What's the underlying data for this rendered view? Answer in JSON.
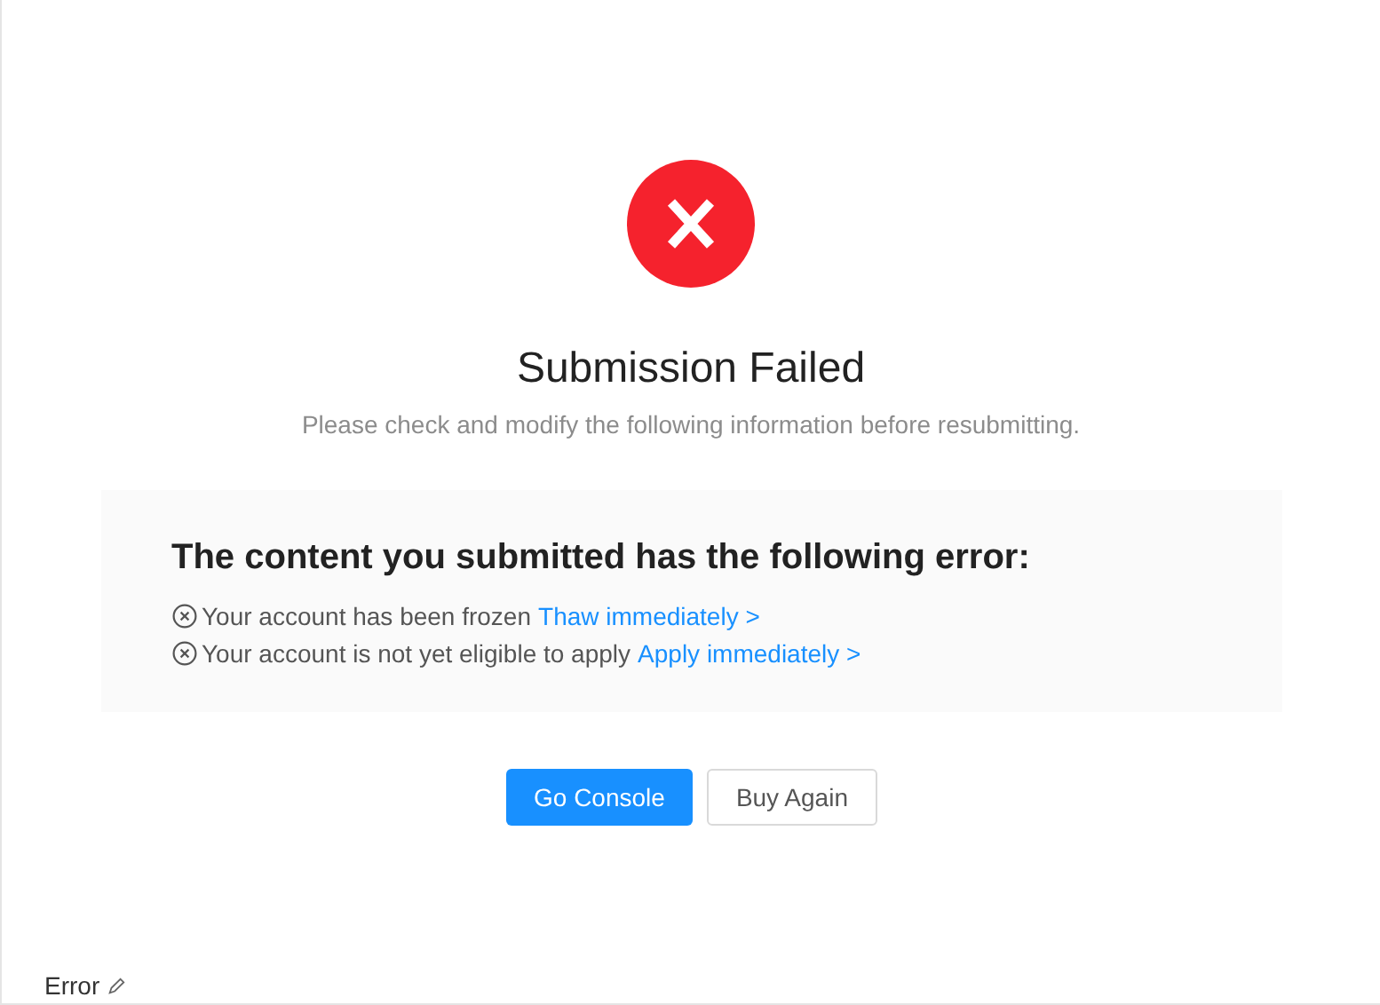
{
  "result": {
    "failed": true,
    "title": "Submission Failed",
    "subtitle": "Please check and modify the following information before resubmitting."
  },
  "error_panel": {
    "heading": "The content you submitted has the following error:",
    "items": [
      {
        "text": "Your account has been frozen",
        "link": "Thaw immediately >"
      },
      {
        "text": "Your account is not yet eligible to apply",
        "link": "Apply immediately >"
      }
    ]
  },
  "buttons": [
    {
      "label": "Go Console",
      "kind": "primary"
    },
    {
      "label": "Buy Again",
      "kind": "default"
    }
  ],
  "footer_label": {
    "text": "Error"
  }
}
